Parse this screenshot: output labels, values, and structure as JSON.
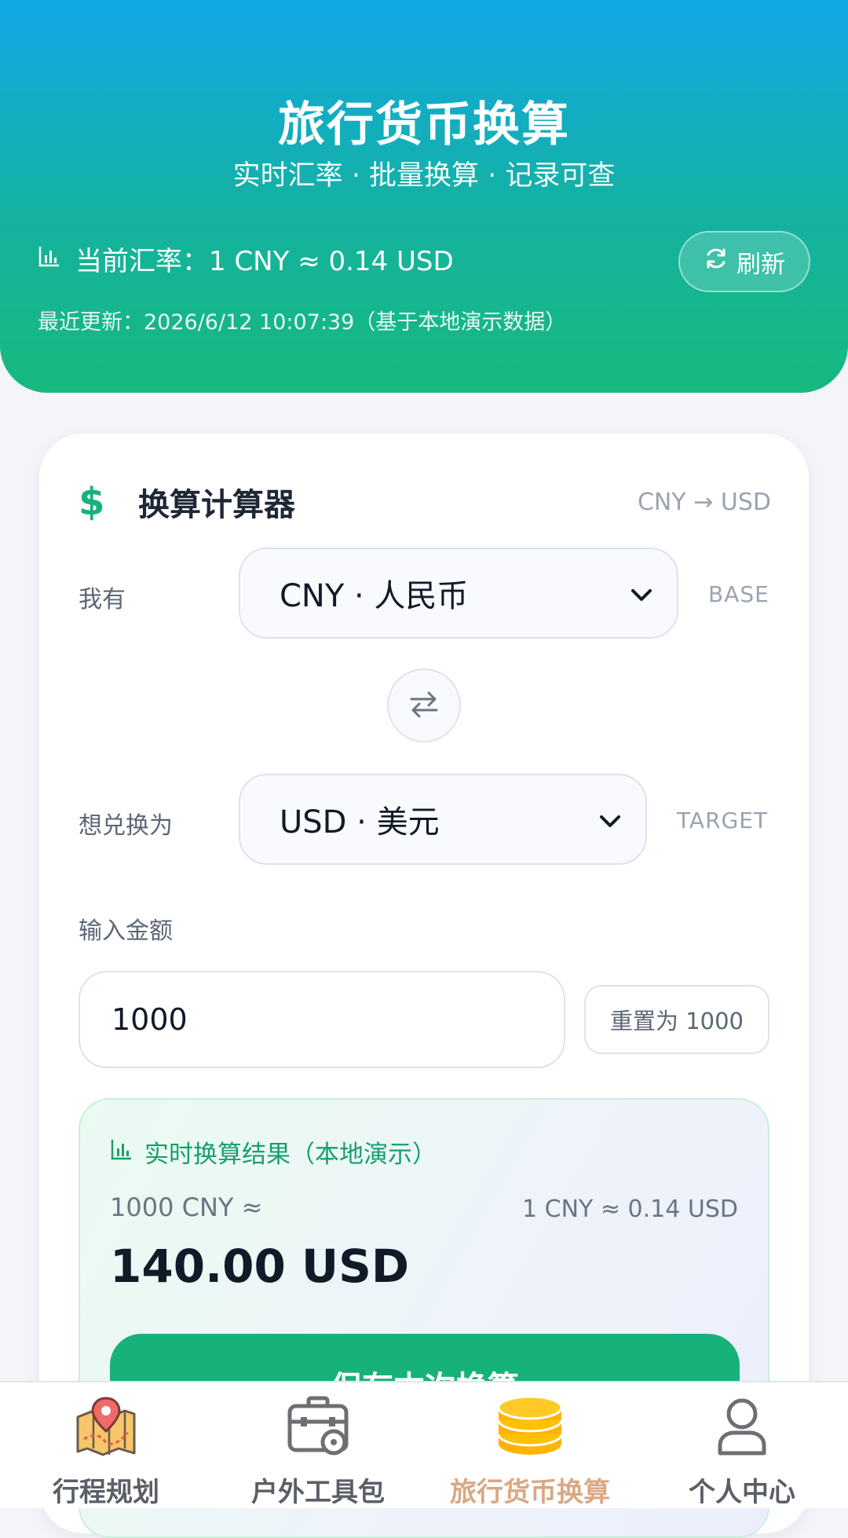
{
  "header": {
    "title": "旅行货币换算",
    "subtitle": "实时汇率 · 批量换算 · 记录可查",
    "rate_text": "当前汇率：1 CNY ≈ 0.14 USD",
    "updated_text": "最近更新：2026/6/12 10:07:39（基于本地演示数据）",
    "refresh_label": "刷新",
    "rate_icon": "bar-chart-icon",
    "refresh_icon": "refresh-icon"
  },
  "converter": {
    "title": "换算计算器",
    "pair": "CNY → USD",
    "from_label": "我有",
    "from_value": "CNY · 人民币",
    "from_tag": "BASE",
    "to_label": "想兑换为",
    "to_value": "USD · 美元",
    "to_tag": "TARGET",
    "amount_label": "输入金额",
    "amount_value": "1000",
    "reset_label": "重置为 1000"
  },
  "result": {
    "heading": "实时换算结果（本地演示）",
    "source_text": "1000 CNY ≈",
    "rate_text": "1 CNY ≈ 0.14 USD",
    "converted": "140.00 USD",
    "save_label": "保存本次换算"
  },
  "nav": {
    "items": [
      {
        "label": "行程规划",
        "icon": "map-pin-icon",
        "active": false
      },
      {
        "label": "户外工具包",
        "icon": "toolbox-icon",
        "active": false
      },
      {
        "label": "旅行货币换算",
        "icon": "coins-icon",
        "active": true
      },
      {
        "label": "个人中心",
        "icon": "user-icon",
        "active": false
      }
    ]
  },
  "colors": {
    "accent_green": "#17b27a",
    "header_top": "#12a7e8",
    "active_nav": "#d9a884",
    "coin": "#ffb300"
  }
}
